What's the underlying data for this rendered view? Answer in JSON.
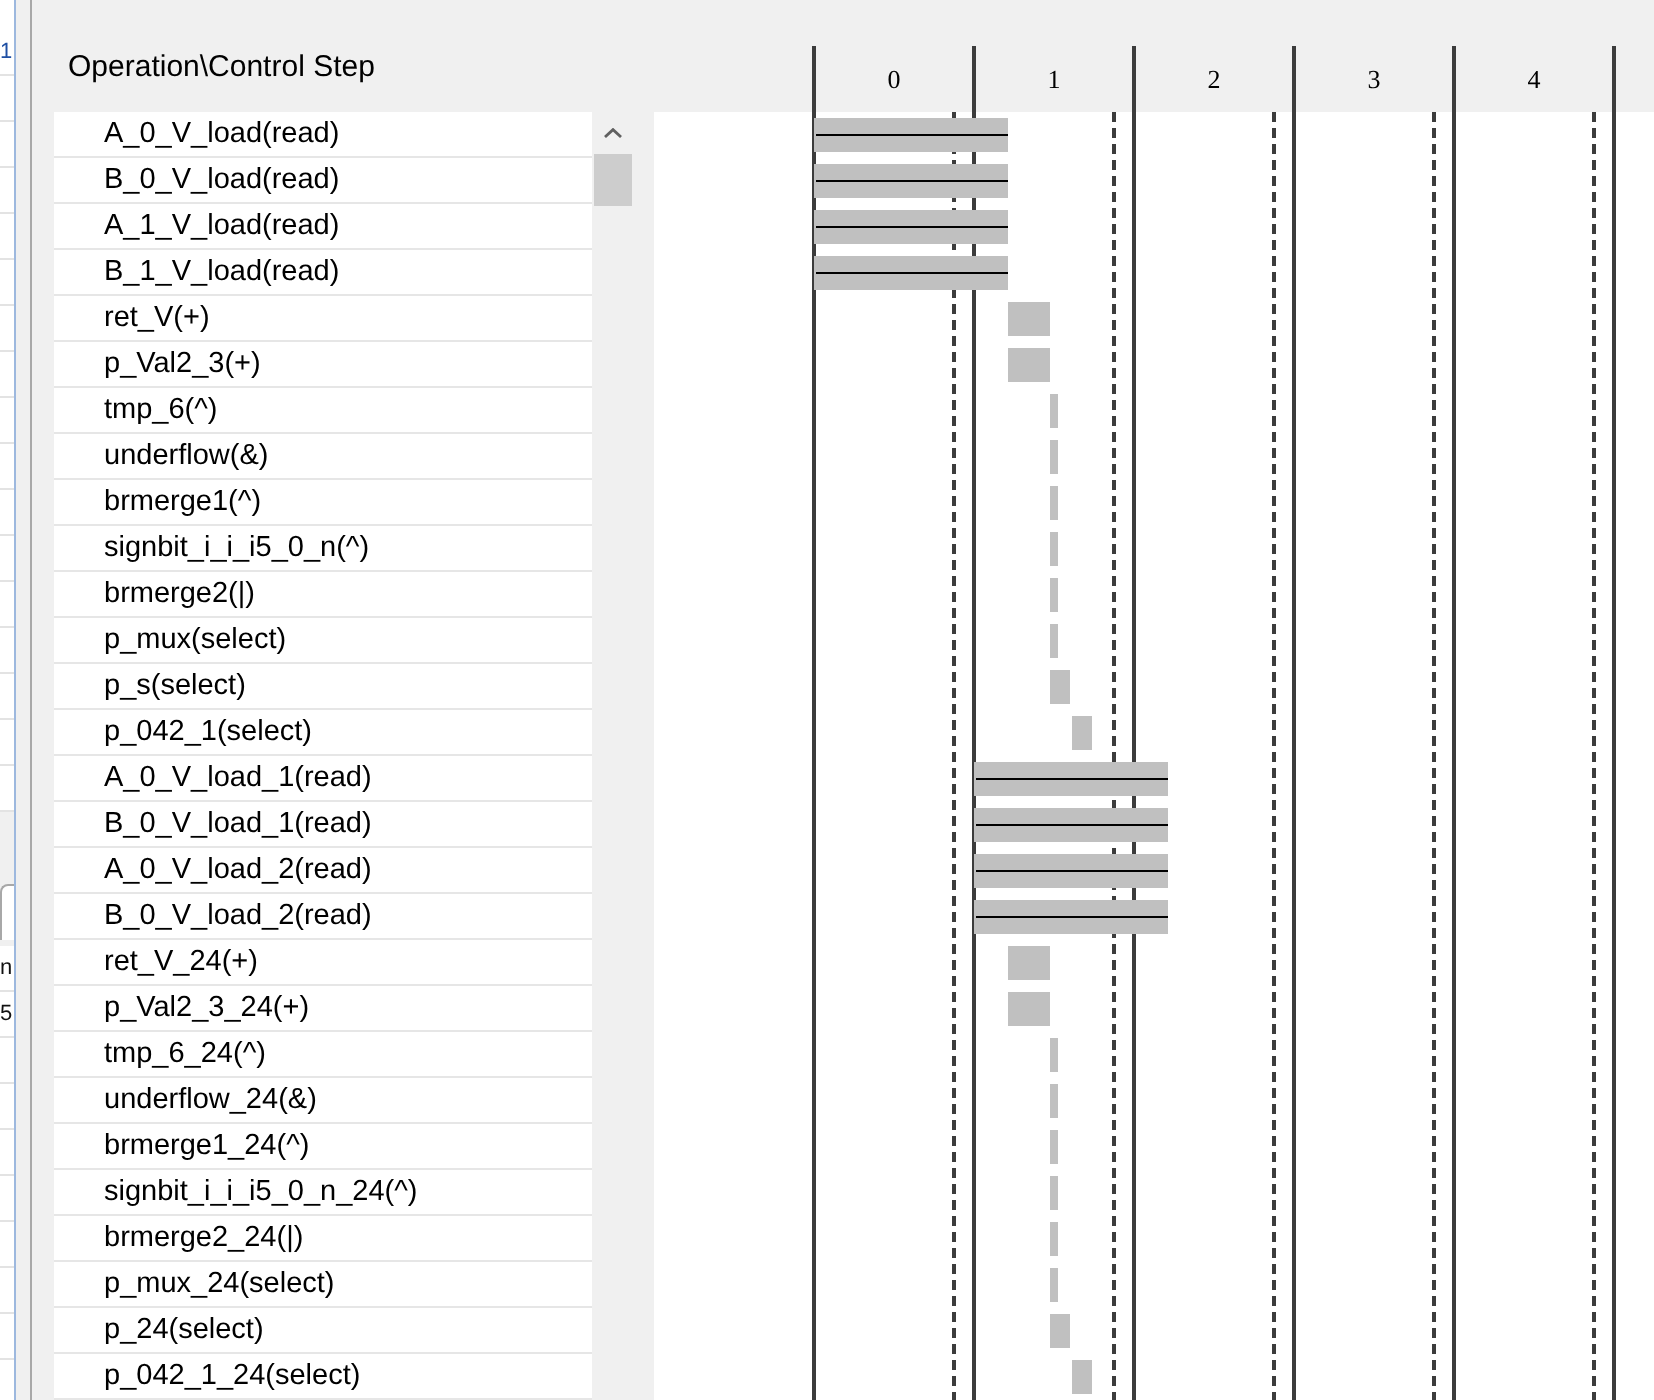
{
  "side_panel": {
    "top_rows": [
      "1"
    ],
    "bottom_rows": [
      "n",
      "5"
    ]
  },
  "schedule": {
    "corner_header": "Operation\\Control Step",
    "steps": [
      "0",
      "1",
      "2",
      "3",
      "4"
    ],
    "operations": [
      "A_0_V_load(read)",
      "B_0_V_load(read)",
      "A_1_V_load(read)",
      "B_1_V_load(read)",
      "ret_V(+)",
      "p_Val2_3(+)",
      "tmp_6(^)",
      "underflow(&)",
      "brmerge1(^)",
      "signbit_i_i_i5_0_n(^)",
      "brmerge2(|)",
      "p_mux(select)",
      "p_s(select)",
      "p_042_1(select)",
      "A_0_V_load_1(read)",
      "B_0_V_load_1(read)",
      "A_0_V_load_2(read)",
      "B_0_V_load_2(read)",
      "ret_V_24(+)",
      "p_Val2_3_24(+)",
      "tmp_6_24(^)",
      "underflow_24(&)",
      "brmerge1_24(^)",
      "signbit_i_i_i5_0_n_24(^)",
      "brmerge2_24(|)",
      "p_mux_24(select)",
      "p_24(select)",
      "p_042_1_24(select)"
    ]
  }
}
